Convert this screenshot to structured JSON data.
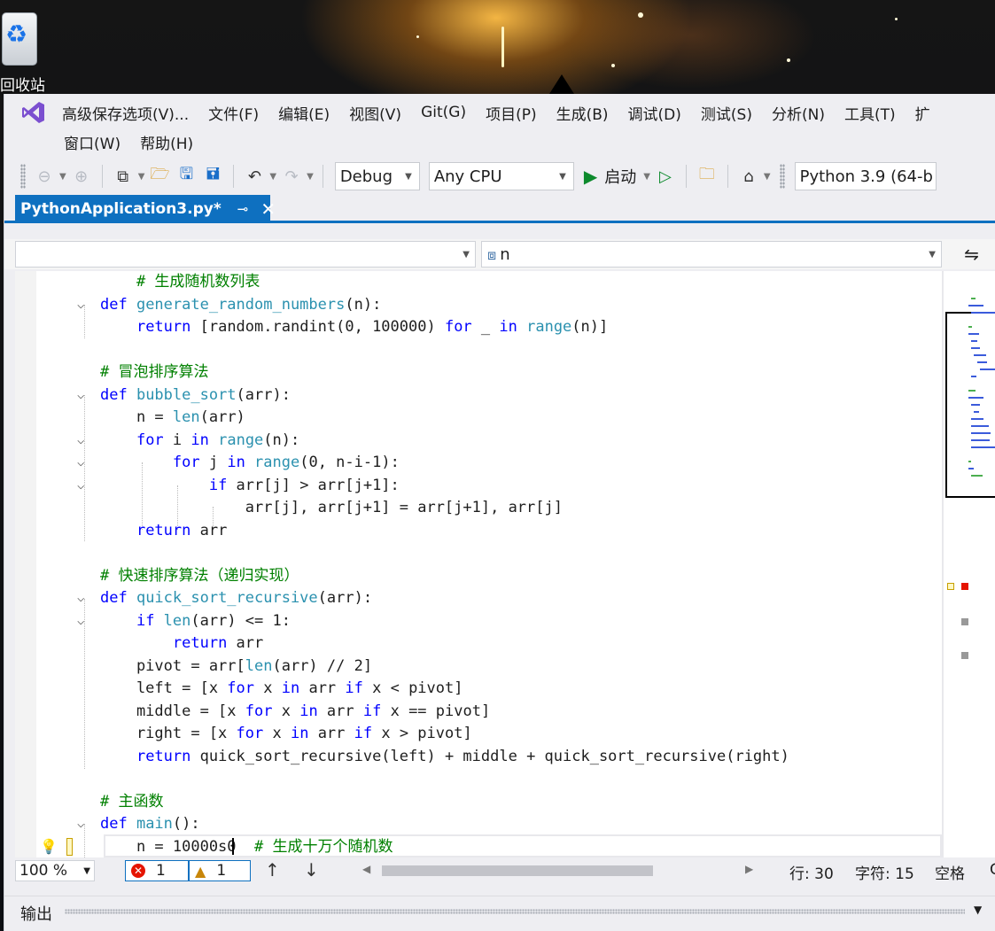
{
  "desktop": {
    "recycle_bin_label": "回收站"
  },
  "menu": {
    "row1": [
      "高级保存选项(V)...",
      "文件(F)",
      "编辑(E)",
      "视图(V)",
      "Git(G)",
      "项目(P)",
      "生成(B)",
      "调试(D)",
      "测试(S)",
      "分析(N)",
      "工具(T)",
      "扩"
    ],
    "row2": [
      "窗口(W)",
      "帮助(H)"
    ]
  },
  "toolbar": {
    "configuration": "Debug",
    "platform": "Any CPU",
    "start_label": "启动",
    "interpreter": "Python 3.9 (64-b"
  },
  "tab": {
    "title": "PythonApplication3.py*"
  },
  "navbar": {
    "left_value": "",
    "member": "n"
  },
  "code_lines": [
    {
      "fold": "",
      "segs": [
        [
          "    ",
          ""
        ],
        [
          "# 生成随机数列表",
          "cm"
        ]
      ]
    },
    {
      "fold": "v",
      "segs": [
        [
          "def ",
          "kw"
        ],
        [
          "generate_random_numbers",
          "fn"
        ],
        [
          "(n):",
          ""
        ]
      ]
    },
    {
      "fold": "",
      "segs": [
        [
          "    ",
          ""
        ],
        [
          "return ",
          "kw"
        ],
        [
          "[random.randint(0, 100000) ",
          ""
        ],
        [
          "for ",
          "kw"
        ],
        [
          "_ ",
          ""
        ],
        [
          "in ",
          "kw"
        ],
        [
          "range",
          "bi"
        ],
        [
          "(n)]",
          ""
        ]
      ]
    },
    {
      "fold": "",
      "segs": [
        [
          "",
          ""
        ]
      ]
    },
    {
      "fold": "",
      "segs": [
        [
          "# 冒泡排序算法",
          "cm"
        ]
      ]
    },
    {
      "fold": "v",
      "segs": [
        [
          "def ",
          "kw"
        ],
        [
          "bubble_sort",
          "fn"
        ],
        [
          "(arr):",
          ""
        ]
      ]
    },
    {
      "fold": "",
      "segs": [
        [
          "    n = ",
          ""
        ],
        [
          "len",
          "bi"
        ],
        [
          "(arr)",
          ""
        ]
      ]
    },
    {
      "fold": "v",
      "segs": [
        [
          "    ",
          ""
        ],
        [
          "for ",
          "kw"
        ],
        [
          "i ",
          ""
        ],
        [
          "in ",
          "kw"
        ],
        [
          "range",
          "bi"
        ],
        [
          "(n):",
          ""
        ]
      ]
    },
    {
      "fold": "v",
      "segs": [
        [
          "        ",
          ""
        ],
        [
          "for ",
          "kw"
        ],
        [
          "j ",
          ""
        ],
        [
          "in ",
          "kw"
        ],
        [
          "range",
          "bi"
        ],
        [
          "(0, n-i-1):",
          ""
        ]
      ]
    },
    {
      "fold": "v",
      "segs": [
        [
          "            ",
          ""
        ],
        [
          "if ",
          "kw"
        ],
        [
          "arr[j] > arr[j+1]:",
          ""
        ]
      ]
    },
    {
      "fold": "",
      "segs": [
        [
          "                arr[j], arr[j+1] = arr[j+1], arr[j]",
          ""
        ]
      ]
    },
    {
      "fold": "",
      "segs": [
        [
          "    ",
          ""
        ],
        [
          "return ",
          "kw"
        ],
        [
          "arr",
          ""
        ]
      ]
    },
    {
      "fold": "",
      "segs": [
        [
          "",
          ""
        ]
      ]
    },
    {
      "fold": "",
      "segs": [
        [
          "# 快速排序算法（递归实现）",
          "cm"
        ]
      ]
    },
    {
      "fold": "v",
      "segs": [
        [
          "def ",
          "kw"
        ],
        [
          "quick_sort_recursive",
          "fn"
        ],
        [
          "(arr):",
          ""
        ]
      ]
    },
    {
      "fold": "v",
      "segs": [
        [
          "    ",
          ""
        ],
        [
          "if ",
          "kw"
        ],
        [
          "len",
          "bi"
        ],
        [
          "(arr) <= 1:",
          ""
        ]
      ]
    },
    {
      "fold": "",
      "segs": [
        [
          "        ",
          ""
        ],
        [
          "return ",
          "kw"
        ],
        [
          "arr",
          ""
        ]
      ]
    },
    {
      "fold": "",
      "segs": [
        [
          "    pivot = arr[",
          ""
        ],
        [
          "len",
          "bi"
        ],
        [
          "(arr) // 2]",
          ""
        ]
      ]
    },
    {
      "fold": "",
      "segs": [
        [
          "    left = [x ",
          ""
        ],
        [
          "for ",
          "kw"
        ],
        [
          "x ",
          ""
        ],
        [
          "in ",
          "kw"
        ],
        [
          "arr ",
          ""
        ],
        [
          "if ",
          "kw"
        ],
        [
          "x < pivot]",
          ""
        ]
      ]
    },
    {
      "fold": "",
      "segs": [
        [
          "    middle = [x ",
          ""
        ],
        [
          "for ",
          "kw"
        ],
        [
          "x ",
          ""
        ],
        [
          "in ",
          "kw"
        ],
        [
          "arr ",
          ""
        ],
        [
          "if ",
          "kw"
        ],
        [
          "x == pivot]",
          ""
        ]
      ]
    },
    {
      "fold": "",
      "segs": [
        [
          "    right = [x ",
          ""
        ],
        [
          "for ",
          "kw"
        ],
        [
          "x ",
          ""
        ],
        [
          "in ",
          "kw"
        ],
        [
          "arr ",
          ""
        ],
        [
          "if ",
          "kw"
        ],
        [
          "x > pivot]",
          ""
        ]
      ]
    },
    {
      "fold": "",
      "segs": [
        [
          "    ",
          ""
        ],
        [
          "return ",
          "kw"
        ],
        [
          "quick_sort_recursive(left) + middle + quick_sort_recursive(right)",
          ""
        ]
      ]
    },
    {
      "fold": "",
      "segs": [
        [
          "",
          ""
        ]
      ]
    },
    {
      "fold": "",
      "segs": [
        [
          "# 主函数",
          "cm"
        ]
      ]
    },
    {
      "fold": "v",
      "segs": [
        [
          "def ",
          "kw"
        ],
        [
          "main",
          "fn"
        ],
        [
          "():",
          ""
        ]
      ]
    },
    {
      "fold": "",
      "segs": [
        [
          "    n = 10000s0  ",
          ""
        ],
        [
          "# 生成十万个随机数",
          "cm"
        ]
      ]
    }
  ],
  "status": {
    "zoom": "100 %",
    "errors": "1",
    "warnings": "1",
    "line": "行: 30",
    "column": "字符: 15",
    "indent": "空格",
    "extra": "C"
  },
  "output_panel": {
    "title": "输出"
  },
  "colors": {
    "accent": "#0e70c0",
    "keyword": "#0000ff",
    "identifier": "#2b91af",
    "comment": "#008000",
    "error": "#e51400",
    "run_green": "#0d8a2d"
  }
}
